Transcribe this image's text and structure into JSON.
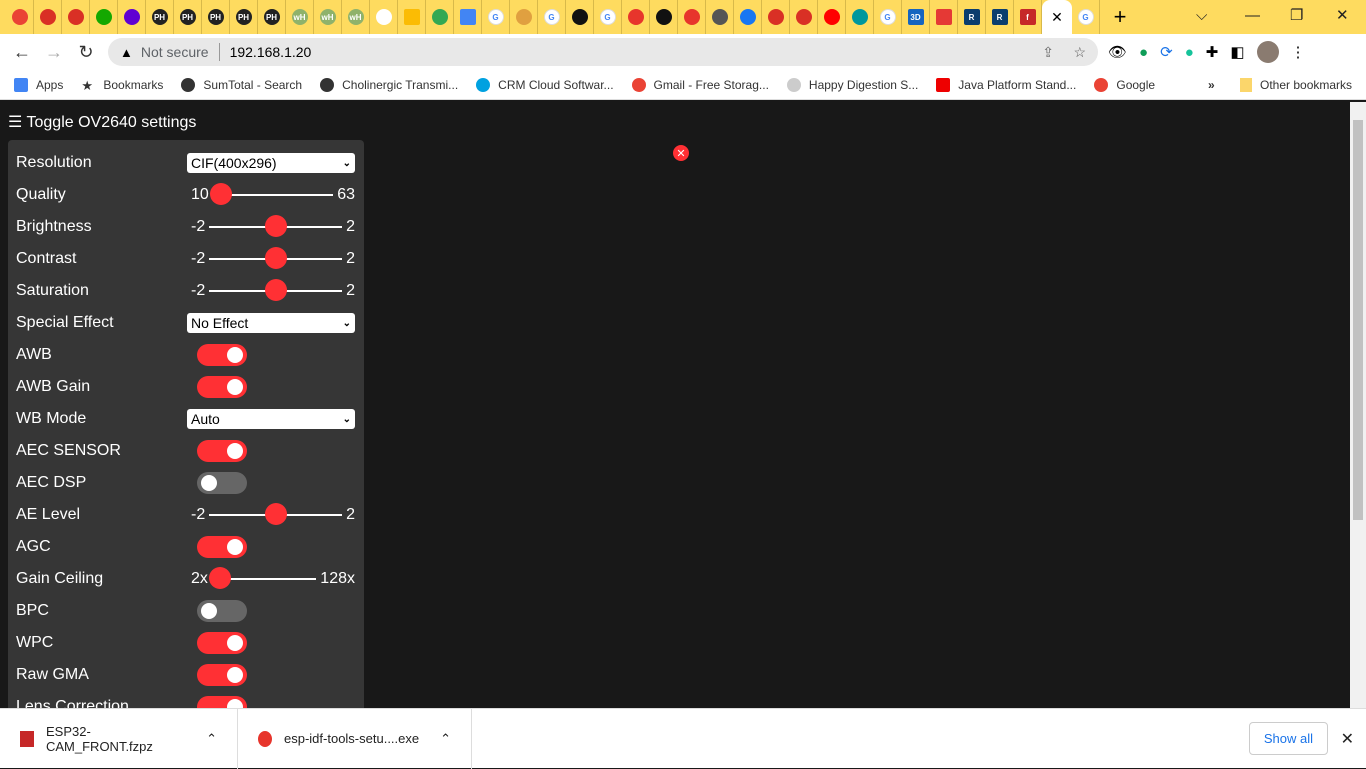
{
  "browser": {
    "tab_favicons": [
      "gmail",
      "red-stripes",
      "red-stripes",
      "upwork",
      "mail",
      "PH",
      "PH",
      "PH",
      "PH",
      "PH",
      "wH",
      "wH",
      "wH",
      "white",
      "keep",
      "drive",
      "docs",
      "google",
      "avatar",
      "google",
      "github",
      "google",
      "espressif",
      "github",
      "espressif",
      "globe",
      "facebook",
      "red-stripes",
      "red-stripes",
      "youtube",
      "arduino",
      "google",
      "3D",
      "grid",
      "R",
      "R",
      "f"
    ],
    "active_tab_close": "✕",
    "new_tab": "+",
    "security_label": "Not secure",
    "url": "192.168.1.20",
    "bookmarks": [
      {
        "label": "Apps",
        "icon": "apps-icon"
      },
      {
        "label": "Bookmarks",
        "icon": "star-icon"
      },
      {
        "label": "SumTotal - Search",
        "icon": "globe-icon"
      },
      {
        "label": "Cholinergic Transmi...",
        "icon": "globe-icon"
      },
      {
        "label": "CRM Cloud Softwar...",
        "icon": "salesforce-icon"
      },
      {
        "label": "Gmail - Free Storag...",
        "icon": "google-icon"
      },
      {
        "label": "Happy Digestion S...",
        "icon": "artichoke-icon"
      },
      {
        "label": "Java Platform Stand...",
        "icon": "oracle-icon"
      },
      {
        "label": "Google",
        "icon": "google-icon"
      }
    ],
    "more_bookmarks": "»",
    "other_bookmarks": "Other bookmarks"
  },
  "page": {
    "toggle_label": "Toggle OV2640 settings",
    "menu_icon": "☰",
    "close_icon": "✕",
    "accent": "#ff3034",
    "settings": [
      {
        "label": "Resolution",
        "type": "select",
        "value": "CIF(400x296)"
      },
      {
        "label": "Quality",
        "type": "range",
        "min": "10",
        "max": "63",
        "fraction": 0
      },
      {
        "label": "Brightness",
        "type": "range",
        "min": "-2",
        "max": "2",
        "fraction": 0.5
      },
      {
        "label": "Contrast",
        "type": "range",
        "min": "-2",
        "max": "2",
        "fraction": 0.5
      },
      {
        "label": "Saturation",
        "type": "range",
        "min": "-2",
        "max": "2",
        "fraction": 0.5
      },
      {
        "label": "Special Effect",
        "type": "select",
        "value": "No Effect"
      },
      {
        "label": "AWB",
        "type": "toggle",
        "on": true
      },
      {
        "label": "AWB Gain",
        "type": "toggle",
        "on": true
      },
      {
        "label": "WB Mode",
        "type": "select",
        "value": "Auto"
      },
      {
        "label": "AEC SENSOR",
        "type": "toggle",
        "on": true
      },
      {
        "label": "AEC DSP",
        "type": "toggle",
        "on": false
      },
      {
        "label": "AE Level",
        "type": "range",
        "min": "-2",
        "max": "2",
        "fraction": 0.5
      },
      {
        "label": "AGC",
        "type": "toggle",
        "on": true
      },
      {
        "label": "Gain Ceiling",
        "type": "range",
        "min": "2x",
        "max": "128x",
        "fraction": 0
      },
      {
        "label": "BPC",
        "type": "toggle",
        "on": false
      },
      {
        "label": "WPC",
        "type": "toggle",
        "on": true
      },
      {
        "label": "Raw GMA",
        "type": "toggle",
        "on": true
      },
      {
        "label": "Lens Correction",
        "type": "toggle",
        "on": true
      }
    ]
  },
  "downloads": {
    "items": [
      {
        "name": "ESP32-CAM_FRONT.fzpz",
        "icon": "fritzing-icon"
      },
      {
        "name": "esp-idf-tools-setu....exe",
        "icon": "espressif-icon"
      }
    ],
    "show_all": "Show all",
    "close": "✕"
  }
}
